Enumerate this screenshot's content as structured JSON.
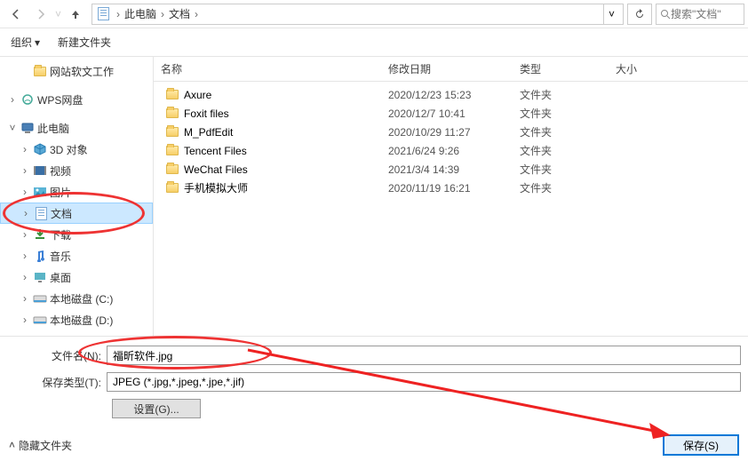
{
  "topbar": {
    "breadcrumb": [
      "此电脑",
      "文档"
    ],
    "search_placeholder": "搜索\"文档\""
  },
  "toolbar": {
    "organize": "组织",
    "new_folder": "新建文件夹"
  },
  "sidebar": {
    "items": [
      {
        "label": "网站软文工作",
        "icon": "folder",
        "level": 2,
        "arrow": ""
      },
      {
        "label": "",
        "spacer": true
      },
      {
        "label": "WPS网盘",
        "icon": "wps",
        "level": 1,
        "arrow": ">"
      },
      {
        "label": "",
        "spacer": true
      },
      {
        "label": "此电脑",
        "icon": "pc",
        "level": 1,
        "arrow": "v"
      },
      {
        "label": "3D 对象",
        "icon": "3d",
        "level": 2,
        "arrow": ">"
      },
      {
        "label": "视频",
        "icon": "video",
        "level": 2,
        "arrow": ">"
      },
      {
        "label": "图片",
        "icon": "pic",
        "level": 2,
        "arrow": ">"
      },
      {
        "label": "文档",
        "icon": "doc",
        "level": 2,
        "arrow": ">",
        "selected": true
      },
      {
        "label": "下载",
        "icon": "dl",
        "level": 2,
        "arrow": ">"
      },
      {
        "label": "音乐",
        "icon": "music",
        "level": 2,
        "arrow": ">"
      },
      {
        "label": "桌面",
        "icon": "desk",
        "level": 2,
        "arrow": ">"
      },
      {
        "label": "本地磁盘 (C:)",
        "icon": "disk",
        "level": 2,
        "arrow": ">"
      },
      {
        "label": "本地磁盘 (D:)",
        "icon": "disk",
        "level": 2,
        "arrow": ">"
      }
    ]
  },
  "columns": {
    "name": "名称",
    "date": "修改日期",
    "type": "类型",
    "size": "大小"
  },
  "files": [
    {
      "name": "Axure",
      "date": "2020/12/23 15:23",
      "type": "文件夹"
    },
    {
      "name": "Foxit files",
      "date": "2020/12/7 10:41",
      "type": "文件夹"
    },
    {
      "name": "M_PdfEdit",
      "date": "2020/10/29 11:27",
      "type": "文件夹"
    },
    {
      "name": "Tencent Files",
      "date": "2021/6/24 9:26",
      "type": "文件夹"
    },
    {
      "name": "WeChat Files",
      "date": "2021/3/4 14:39",
      "type": "文件夹"
    },
    {
      "name": "手机模拟大师",
      "date": "2020/11/19 16:21",
      "type": "文件夹"
    }
  ],
  "form": {
    "filename_label": "文件名(N):",
    "filetype_label": "保存类型(T):",
    "filename_value": "福昕软件.jpg",
    "filetype_value": "JPEG (*.jpg,*.jpeg,*.jpe,*.jif)",
    "settings_label": "设置(G)...",
    "hide_folders": "隐藏文件夹",
    "save_label": "保存(S)"
  }
}
